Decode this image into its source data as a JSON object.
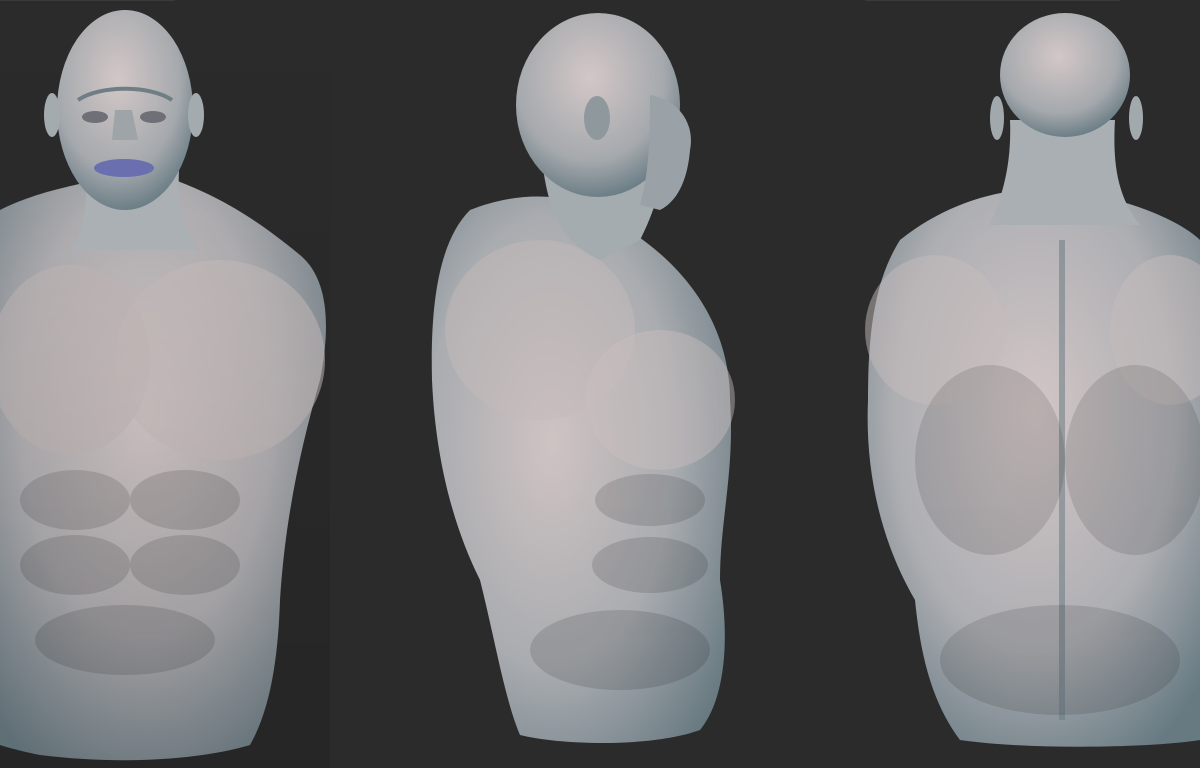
{
  "scene": {
    "background_color": "#2b2b2b",
    "views": [
      {
        "id": "front",
        "description_label": ""
      },
      {
        "id": "side",
        "description_label": ""
      },
      {
        "id": "back",
        "description_label": ""
      }
    ]
  },
  "colors": {
    "skin_light": "#c9bcbc",
    "skin_mid": "#9fa6aa",
    "skin_shadow": "#5f7178",
    "lip": "#6a6fb0"
  }
}
